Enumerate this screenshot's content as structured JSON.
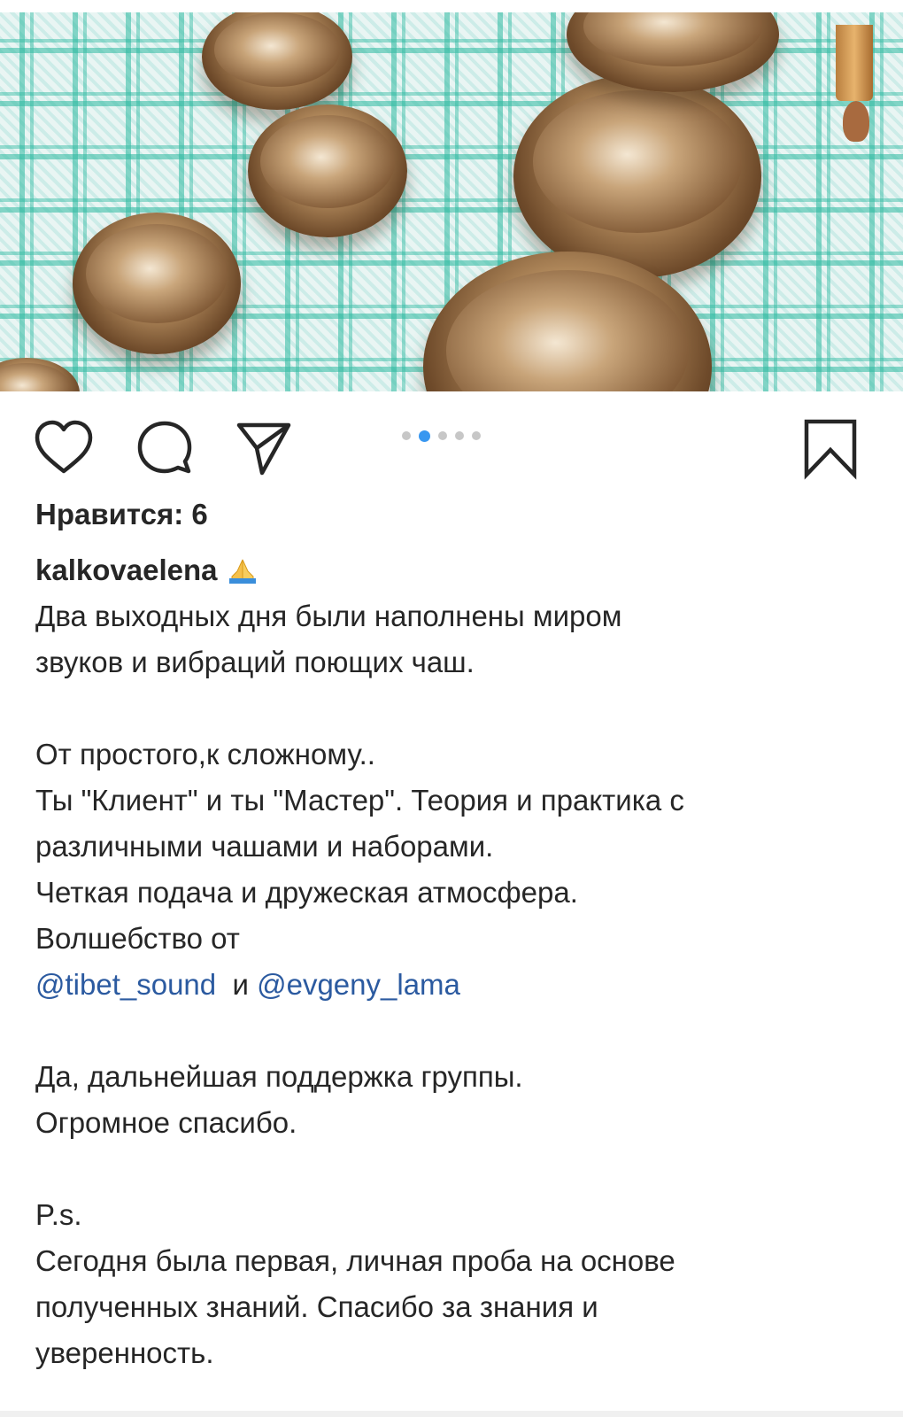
{
  "post": {
    "likes_text": "Нравится: 6",
    "author": "kalkovaelena",
    "emoji": "🙏",
    "carousel": {
      "count": 5,
      "active_index": 1
    },
    "caption": {
      "p1_l1": "Два выходных дня были наполнены миром",
      "p1_l2": "звуков и вибраций поющих чаш.",
      "p2_l1": "От простого,к сложному..",
      "p2_l2": "Ты \"Клиент\" и ты \"Мастер\". Теория и практика с",
      "p2_l3": "различными чашами и наборами.",
      "p2_l4": "Четкая подача и дружеская атмосфера.",
      "p2_l5": "Волшебство от",
      "mention1": "@tibet_sound",
      "and": "и",
      "mention2": "@evgeny_lama",
      "p3_l1": "Да, дальнейшая поддержка группы.",
      "p3_l2": "Огромное спасибо.",
      "p4_l1": "P.s.",
      "p4_l2": "Сегодня была первая, личная проба на основе",
      "p4_l3": "полученных знаний. Спасибо за знания и",
      "p4_l4": "уверенность."
    }
  },
  "icons": {
    "like": "heart-icon",
    "comment": "comment-icon",
    "share": "paper-plane-icon",
    "save": "bookmark-icon"
  },
  "colors": {
    "text": "#262626",
    "mention": "#2b5aa0",
    "active_dot": "#3897f0",
    "inactive_dot": "#c7c7c7"
  }
}
